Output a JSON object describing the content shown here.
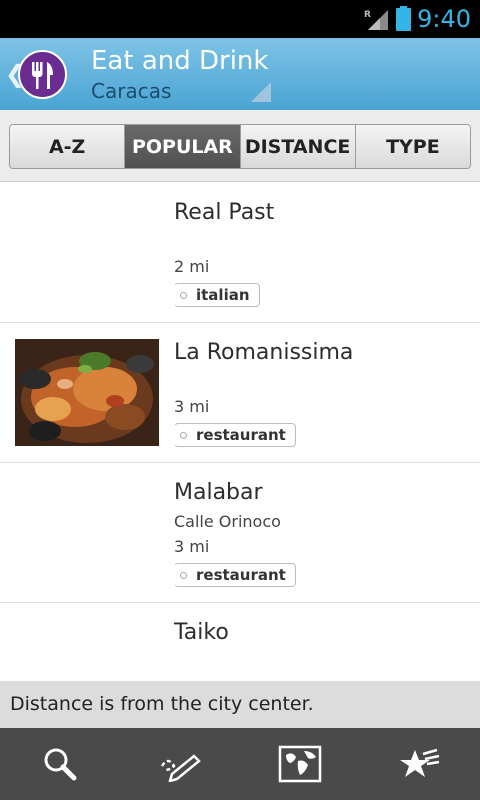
{
  "status_bar": {
    "time": "9:40",
    "network_letter": "R"
  },
  "action_bar": {
    "title": "Eat and Drink",
    "subtitle": "Caracas",
    "up_icon": "chevron-left-icon",
    "app_icon": "fork-knife-icon"
  },
  "tabs": [
    {
      "label": "A-Z",
      "active": false
    },
    {
      "label": "POPULAR",
      "active": true
    },
    {
      "label": "DISTANCE",
      "active": false
    },
    {
      "label": "TYPE",
      "active": false
    }
  ],
  "places": [
    {
      "name": "Real Past",
      "address": "",
      "distance": "2 mi",
      "type": "italian",
      "has_photo": false
    },
    {
      "name": "La Romanissima",
      "address": "",
      "distance": "3 mi",
      "type": "restaurant",
      "has_photo": true
    },
    {
      "name": "Malabar",
      "address": "Calle Orinoco",
      "distance": "3 mi",
      "type": "restaurant",
      "has_photo": false
    },
    {
      "name": "Taiko",
      "address": "",
      "distance": "",
      "type": "",
      "has_photo": false
    }
  ],
  "info_bar": {
    "text": "Distance is from the city center."
  },
  "toolbar": {
    "icons": [
      "search-icon",
      "edit-note-icon",
      "map-icon",
      "favorites-icon"
    ]
  },
  "colors": {
    "status_accent": "#33b5e5",
    "action_bar": "#5aaedb",
    "app_icon_bg": "#6a2c91",
    "toolbar_bg": "#4a4a4a"
  }
}
